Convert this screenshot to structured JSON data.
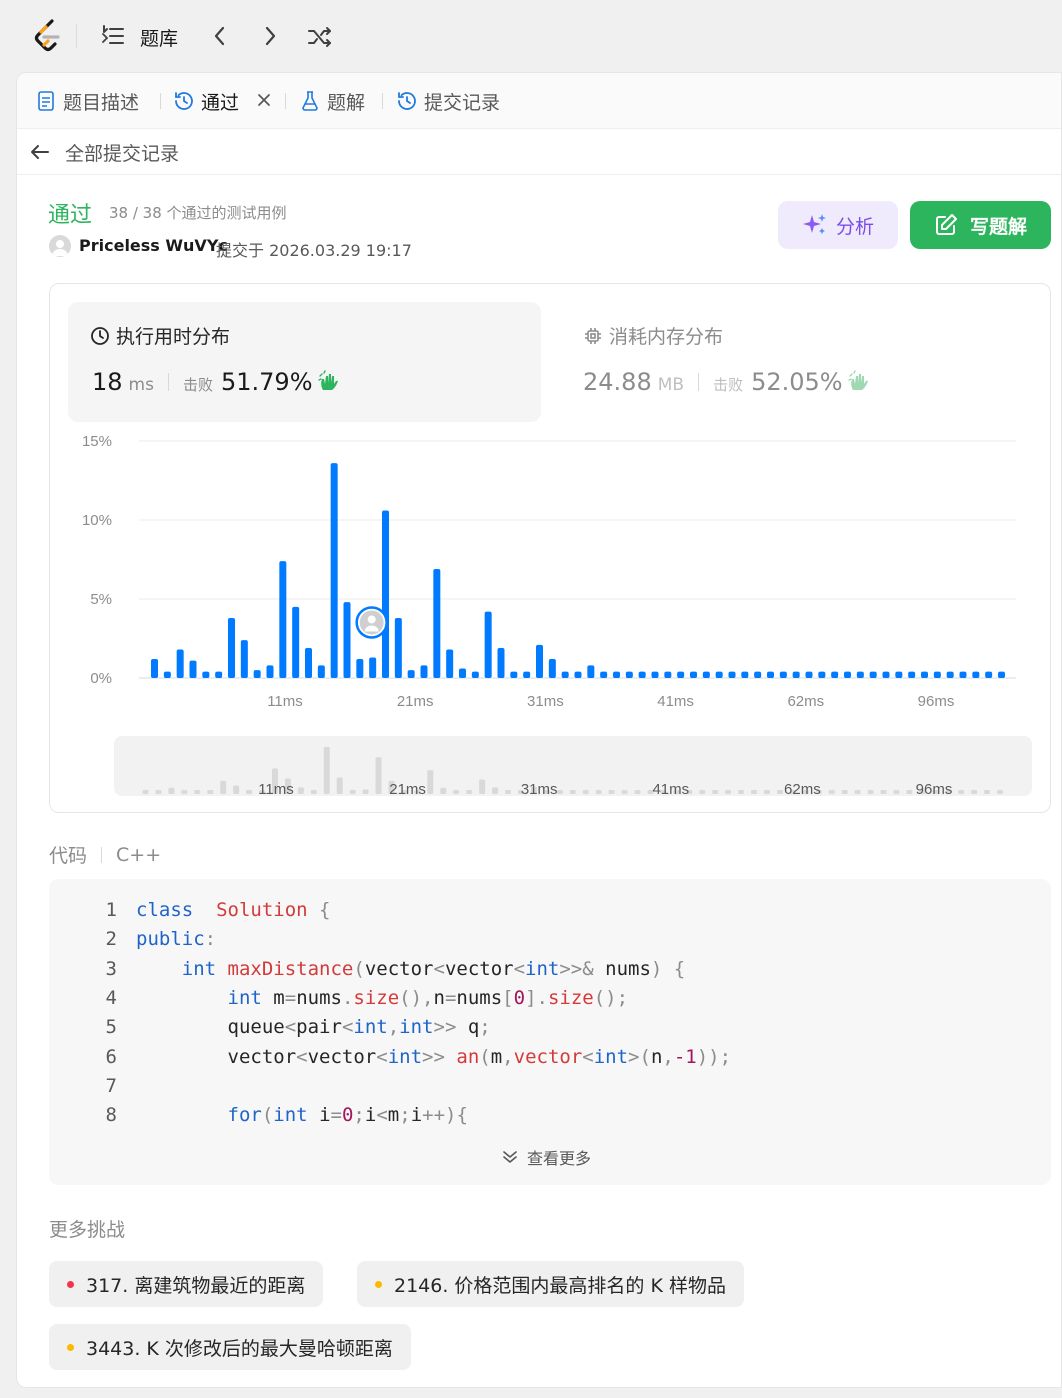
{
  "nav": {
    "title": "题库"
  },
  "tabs": [
    {
      "label": "题目描述"
    },
    {
      "label": "通过"
    },
    {
      "label": "题解"
    },
    {
      "label": "提交记录"
    }
  ],
  "back": {
    "label": "全部提交记录"
  },
  "submission": {
    "status": "通过",
    "cases": "38 / 38 个通过的测试用例",
    "user": "Priceless WuVYc",
    "submitted_at": "提交于 2026.03.29 19:17"
  },
  "actions": {
    "analyze": "分析",
    "write_solution": "写题解"
  },
  "runtime": {
    "title": "执行用时分布",
    "value": "18",
    "unit": "ms",
    "beat_label": "击败",
    "beat": "51.79%"
  },
  "memory": {
    "title": "消耗内存分布",
    "value": "24.88",
    "unit": "MB",
    "beat_label": "击败",
    "beat": "52.05%"
  },
  "chart_data": {
    "type": "bar",
    "title": "执行用时分布",
    "yticks": [
      "15%",
      "10%",
      "5%",
      "0%"
    ],
    "ylim": [
      0,
      15
    ],
    "xticks": [
      "11ms",
      "21ms",
      "31ms",
      "41ms",
      "62ms",
      "96ms"
    ],
    "values": [
      1.2,
      0.4,
      1.8,
      1.1,
      0.4,
      0.4,
      3.8,
      2.4,
      0.5,
      0.8,
      7.4,
      4.5,
      1.9,
      0.8,
      13.6,
      4.8,
      1.2,
      1.3,
      10.6,
      3.8,
      0.5,
      0.8,
      6.9,
      1.8,
      0.6,
      0.4,
      4.2,
      1.9,
      0.4,
      0.4,
      2.1,
      1.2,
      0.4,
      0.4,
      0.8,
      0.4,
      0.4,
      0.4,
      0.4,
      0.4,
      0.4,
      0.4,
      0.4,
      0.4,
      0.4,
      0.4,
      0.4,
      0.4,
      0.4,
      0.4,
      0.4,
      0.4,
      0.4,
      0.4,
      0.4,
      0.4,
      0.4,
      0.4,
      0.4,
      0.4,
      0.4,
      0.4,
      0.4,
      0.4,
      0.4,
      0.4,
      0.4
    ],
    "highlight_index": 17,
    "bar_color": "#007aff"
  },
  "code": {
    "label": "代码",
    "language": "C++",
    "more": "查看更多",
    "lines": [
      [
        [
          "kw",
          "class"
        ],
        [
          "",
          "  "
        ],
        [
          "fn",
          "Solution"
        ],
        [
          "pn",
          " {"
        ]
      ],
      [
        [
          "kw",
          "public"
        ],
        [
          "pn",
          ":"
        ]
      ],
      [
        [
          "",
          "    "
        ],
        [
          "ty",
          "int"
        ],
        [
          "",
          " "
        ],
        [
          "fn",
          "maxDistance"
        ],
        [
          "pn",
          "("
        ],
        [
          "",
          "vector"
        ],
        [
          "pn",
          "<"
        ],
        [
          "",
          "vector"
        ],
        [
          "pn",
          "<"
        ],
        [
          "ty",
          "int"
        ],
        [
          "pn",
          ">>&"
        ],
        [
          "",
          " nums"
        ],
        [
          "pn",
          ") {"
        ]
      ],
      [
        [
          "",
          "        "
        ],
        [
          "ty",
          "int"
        ],
        [
          "",
          " m"
        ],
        [
          "pn",
          "="
        ],
        [
          "",
          "nums"
        ],
        [
          "pn",
          "."
        ],
        [
          "fn",
          "size"
        ],
        [
          "pn",
          "(),"
        ],
        [
          "",
          "n"
        ],
        [
          "pn",
          "="
        ],
        [
          "",
          "nums"
        ],
        [
          "pn",
          "["
        ],
        [
          "nm",
          "0"
        ],
        [
          "pn",
          "]."
        ],
        [
          "fn",
          "size"
        ],
        [
          "pn",
          "();"
        ]
      ],
      [
        [
          "",
          "        queue"
        ],
        [
          "pn",
          "<"
        ],
        [
          "",
          "pair"
        ],
        [
          "pn",
          "<"
        ],
        [
          "ty",
          "int"
        ],
        [
          "pn",
          ","
        ],
        [
          "ty",
          "int"
        ],
        [
          "pn",
          ">>"
        ],
        [
          "",
          " q"
        ],
        [
          "pn",
          ";"
        ]
      ],
      [
        [
          "",
          "        vector"
        ],
        [
          "pn",
          "<"
        ],
        [
          "",
          "vector"
        ],
        [
          "pn",
          "<"
        ],
        [
          "ty",
          "int"
        ],
        [
          "pn",
          ">>"
        ],
        [
          "",
          " "
        ],
        [
          "fn",
          "an"
        ],
        [
          "pn",
          "("
        ],
        [
          "",
          "m"
        ],
        [
          "pn",
          ","
        ],
        [
          "fn",
          "vector"
        ],
        [
          "pn",
          "<"
        ],
        [
          "ty",
          "int"
        ],
        [
          "pn",
          ">("
        ],
        [
          "",
          "n"
        ],
        [
          "pn",
          ","
        ],
        [
          "nm",
          "-1"
        ],
        [
          "pn",
          "));"
        ]
      ],
      [],
      [
        [
          "",
          "        "
        ],
        [
          "kw",
          "for"
        ],
        [
          "pn",
          "("
        ],
        [
          "ty",
          "int"
        ],
        [
          "",
          " i"
        ],
        [
          "pn",
          "="
        ],
        [
          "nm",
          "0"
        ],
        [
          "pn",
          ";"
        ],
        [
          "",
          "i"
        ],
        [
          "pn",
          "<"
        ],
        [
          "",
          "m"
        ],
        [
          "pn",
          ";"
        ],
        [
          "",
          "i"
        ],
        [
          "pn",
          "++){"
        ]
      ]
    ]
  },
  "more_challenges": {
    "title": "更多挑战",
    "items": [
      {
        "label": "317. 离建筑物最近的距离",
        "color": "#f5334b"
      },
      {
        "label": "2146. 价格范围内最高排名的 K 样物品",
        "color": "#ffb800"
      },
      {
        "label": "3443. K 次修改后的最大曼哈顿距离",
        "color": "#ffb800"
      }
    ]
  }
}
